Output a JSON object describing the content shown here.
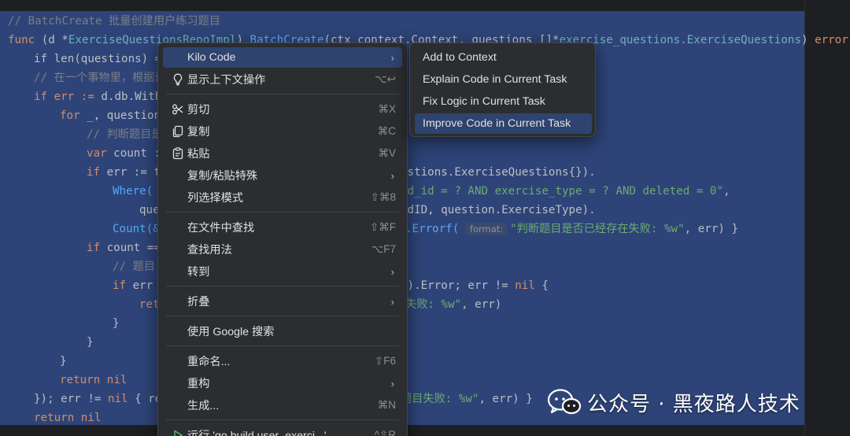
{
  "editor": {
    "lines": {
      "l1": "// BatchCreate 批量创建用户练习题目",
      "l2_kw": "func",
      "l2_recv": " (d *",
      "l2_type": "ExerciseQuestionsRepoImpl",
      "l2_mid": ") ",
      "l2_fn": "BatchCreate",
      "l2_args": "(ctx context.Context, questions []*",
      "l2_type2": "exercise_questions.ExerciseQuestions",
      "l2_end": ") ",
      "l2_err": "error",
      "l2_brace": " {",
      "l3": "if len(questions) =",
      "l4": "// 在一个事物里，根据请",
      "l5_a": "if err := ",
      "l5_b": "d.db.With",
      "l6_a": "for",
      "l6_b": " _, question",
      "l7": "// 判断题目是",
      "l8_a": "var",
      "l8_b": " count :",
      "l9_a": "if",
      "l9_b": " err := t",
      "l9_r": "estions.ExerciseQuestions{}).",
      "l10_a": "Where(",
      "l10_r1": "rd_id = ? AND exercise_type = ? AND deleted = 0\"",
      "l10_r2": ",",
      "l11_a": "que",
      "l11_r": "rdID, question.ExerciseType).",
      "l12_a": "Count(&",
      "l12_r1": ".Errorf(",
      "l12_hint": "format:",
      "l12_r2": "\"判断题目是否已经存在失败: %w\"",
      "l12_r3": ", err) }",
      "l13_a": "if",
      "l13_b": " count ==",
      "l14": "// 题目",
      "l15_a": "if",
      "l15_b": " err",
      "l15_r": "n).Error; err != ",
      "l15_nil": "nil",
      "l15_end": " {",
      "l16_a": "ret",
      "l16_r1": "失败: %w\"",
      "l16_r2": ", err)",
      "l17": "}",
      "l18": "}",
      "l19": "}",
      "l20_a": "return",
      "l20_b": " nil",
      "l21_a": "}); err != ",
      "l21_nil": "nil",
      "l21_b": " { re",
      "l21_r1": "题目失败: %w\"",
      "l21_r2": ", err) }",
      "l22_a": "return",
      "l22_b": " nil"
    }
  },
  "context_menu": {
    "items": [
      {
        "label": "Kilo Code",
        "shortcut": "",
        "arrow": "›",
        "icon": ""
      },
      {
        "label": "显示上下文操作",
        "shortcut": "⌥↩",
        "icon": "💡"
      },
      {
        "label": "剪切",
        "shortcut": "⌘X",
        "icon": "✂"
      },
      {
        "label": "复制",
        "shortcut": "⌘C",
        "icon": "⧉"
      },
      {
        "label": "粘贴",
        "shortcut": "⌘V",
        "icon": "📋"
      },
      {
        "label": "复制/粘贴特殊",
        "shortcut": "",
        "arrow": "›"
      },
      {
        "label": "列选择模式",
        "shortcut": "⇧⌘8"
      },
      {
        "label": "在文件中查找",
        "shortcut": "⇧⌘F"
      },
      {
        "label": "查找用法",
        "shortcut": "⌥F7"
      },
      {
        "label": "转到",
        "shortcut": "",
        "arrow": "›"
      },
      {
        "label": "折叠",
        "shortcut": "",
        "arrow": "›"
      },
      {
        "label": "使用 Google 搜索",
        "shortcut": ""
      },
      {
        "label": "重命名...",
        "shortcut": "⇧F6"
      },
      {
        "label": "重构",
        "shortcut": "",
        "arrow": "›"
      },
      {
        "label": "生成...",
        "shortcut": "⌘N"
      },
      {
        "label": "运行 'go build user_exerci...'",
        "shortcut": "^⇧R",
        "icon": "▷"
      }
    ]
  },
  "submenu": {
    "items": [
      {
        "label": "Add to Context"
      },
      {
        "label": "Explain Code in Current Task"
      },
      {
        "label": "Fix Logic in Current Task"
      },
      {
        "label": "Improve Code in Current Task"
      }
    ]
  },
  "watermark": {
    "text": "公众号 · 黑夜路人技术"
  },
  "colors": {
    "selection": "#2e4478",
    "menu_bg": "#2b2d30",
    "menu_active": "#2e436e",
    "keyword": "#cf8e6d",
    "function": "#56a8f5",
    "comment": "#7a7e85",
    "string": "#6aab73"
  }
}
